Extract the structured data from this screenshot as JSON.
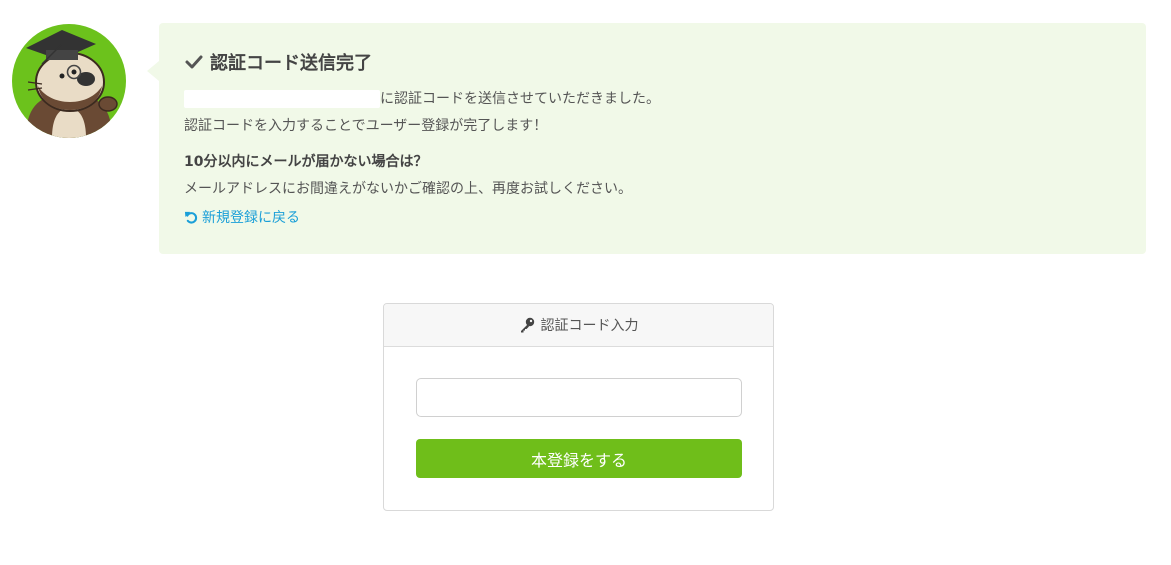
{
  "avatar": {
    "icon": "otter-professor-mascot-icon"
  },
  "notice": {
    "title": "認証コード送信完了",
    "title_icon": "check-icon",
    "sent_message": "に認証コードを送信させていただきました。",
    "complete_message": "認証コードを入力することでユーザー登録が完了します！",
    "help_heading": "10分以内にメールが届かない場合は？",
    "help_text": "メールアドレスにお間違えがないかご確認の上、再度お試しください。",
    "back_link": "新規登録に戻る",
    "back_icon": "undo-icon"
  },
  "code_form": {
    "header": "認証コード入力",
    "header_icon": "key-icon",
    "input_value": "",
    "submit_label": "本登録をする"
  },
  "colors": {
    "notice_bg": "#f1f9e8",
    "accent_green": "#6fbe1a",
    "link_blue": "#1a9fd8"
  }
}
